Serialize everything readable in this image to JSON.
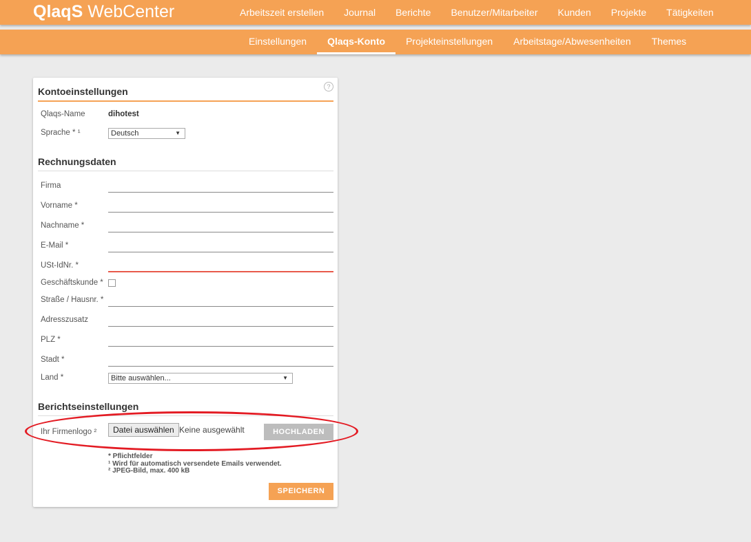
{
  "brand": {
    "name_bold": "QlaqS",
    "name_rest": "WebCenter"
  },
  "main_nav": [
    "Arbeitszeit erstellen",
    "Journal",
    "Berichte",
    "Benutzer/Mitarbeiter",
    "Kunden",
    "Projekte",
    "Tätigkeiten"
  ],
  "sub_nav": [
    "Einstellungen",
    "Qlaqs-Konto",
    "Projekteinstellungen",
    "Arbeitstage/Abwesenheiten",
    "Themes"
  ],
  "sub_nav_active": "Qlaqs-Konto",
  "help_icon": "?",
  "account": {
    "title": "Kontoeinstellungen",
    "name_label": "Qlaqs-Name",
    "name_value": "dihotest",
    "language_label": "Sprache * ¹",
    "language_value": "Deutsch"
  },
  "billing": {
    "title": "Rechnungsdaten",
    "company_label": "Firma",
    "firstname_label": "Vorname *",
    "lastname_label": "Nachname *",
    "email_label": "E-Mail *",
    "vat_label": "USt-IdNr. *",
    "business_label": "Geschäftskunde *",
    "street_label": "Straße / Hausnr. *",
    "address_extra_label": "Adresszusatz",
    "zip_label": "PLZ *",
    "city_label": "Stadt *",
    "country_label": "Land *",
    "country_value": "Bitte auswählen..."
  },
  "report": {
    "title": "Berichtseinstellungen",
    "logo_label": "Ihr Firmenlogo ²",
    "choose_file": "Datei auswählen",
    "file_status": "Keine ausgewählt",
    "upload": "HOCHLADEN"
  },
  "notes": {
    "required": "* Pflichtfelder",
    "note1": "¹ Wird für automatisch versendete Emails verwendet.",
    "note2": "² JPEG-Bild, max. 400 kB"
  },
  "save": "SPEICHERN",
  "colors": {
    "accent": "#f5a254",
    "error": "#e8594a",
    "highlight": "#e31b23"
  }
}
